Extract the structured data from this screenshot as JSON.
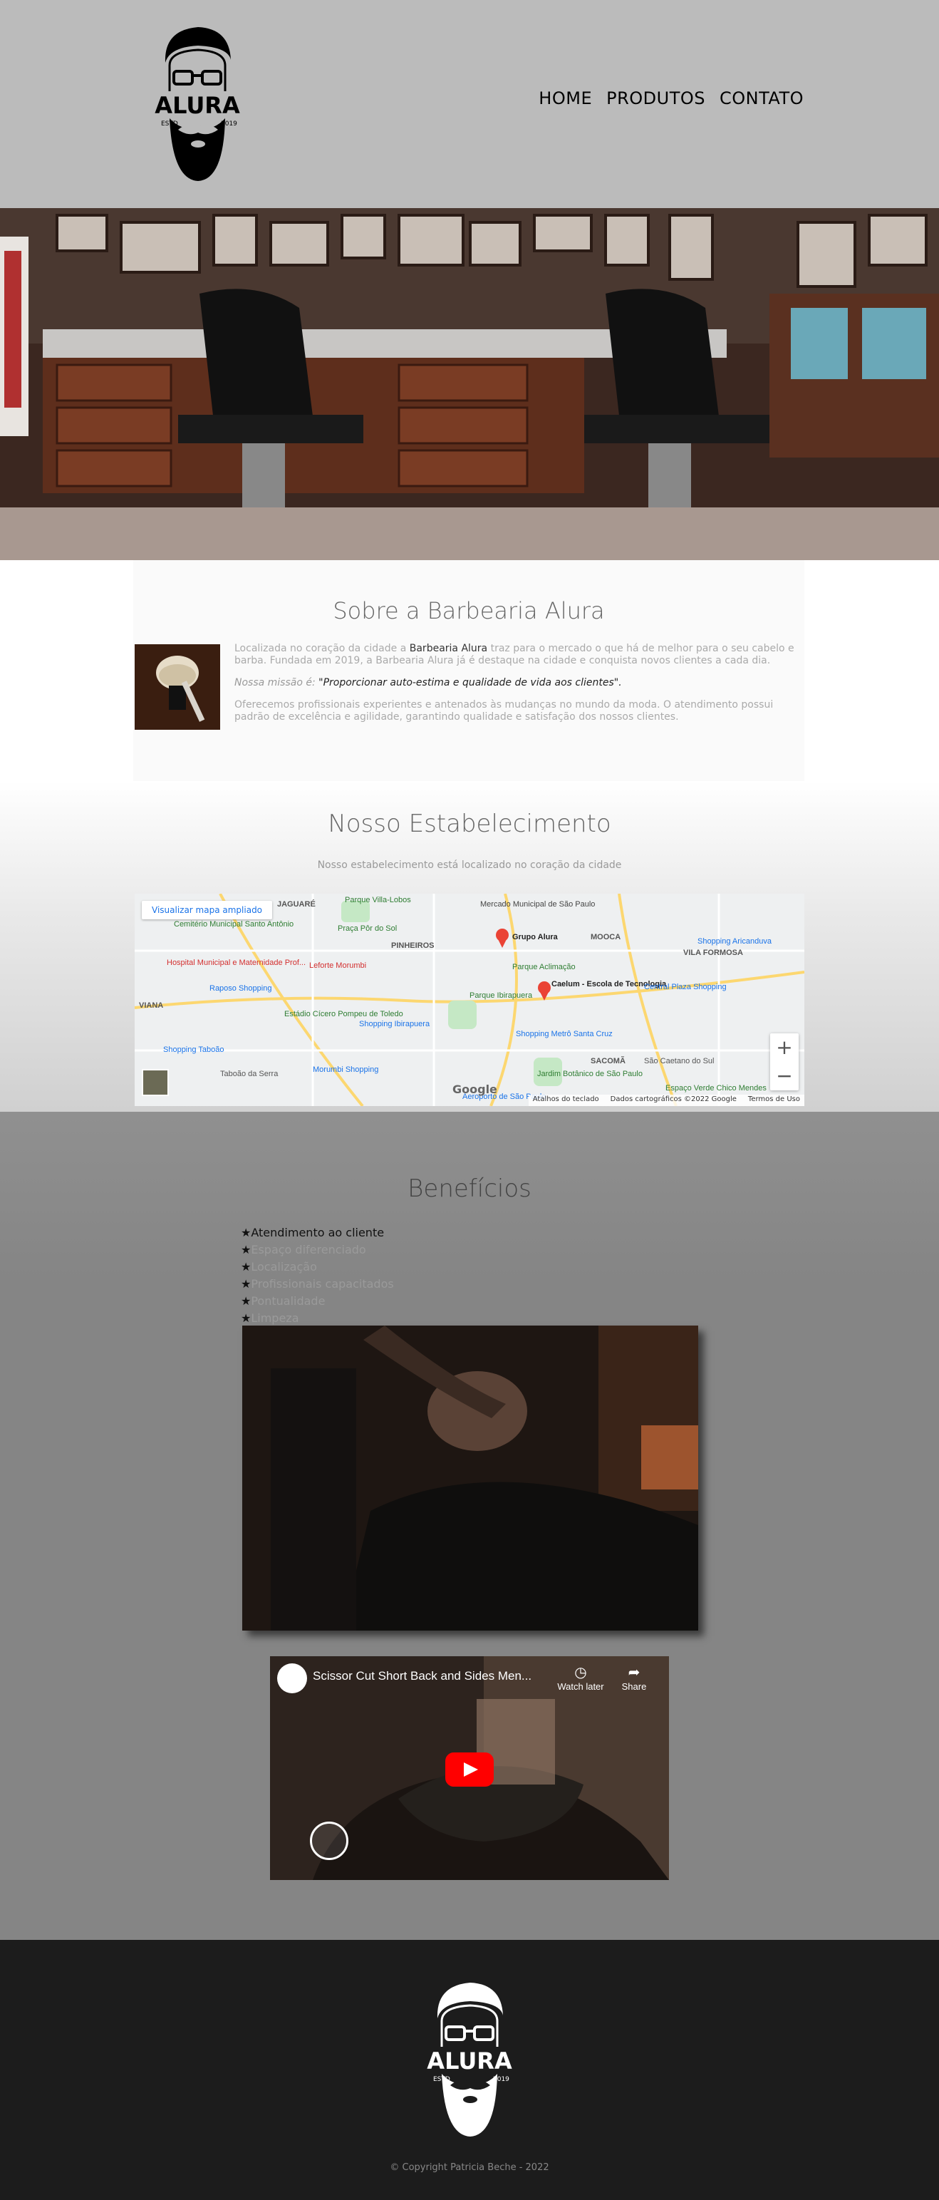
{
  "header": {
    "logo_alt": "Alura barbearia logo",
    "logo_text": "ALURA",
    "logo_estd": "ESTD",
    "logo_year": "2019",
    "nav": [
      {
        "label": "HOME"
      },
      {
        "label": "PRODUTOS"
      },
      {
        "label": "CONTATO"
      }
    ]
  },
  "sobre": {
    "title": "Sobre a Barbearia Alura",
    "p1_a": "Localizada no coração da cidade a ",
    "p1_strong": "Barbearia Alura",
    "p1_b": " traz para o mercado o que há de melhor para o seu cabelo e barba. Fundada em 2019, a Barbearia Alura já é destaque na cidade e conquista novos clientes a cada dia.",
    "p2_em": "Nossa missão é:",
    "p2_quote": " \"Proporcionar auto-estima e qualidade de vida aos clientes\".",
    "p3": "Oferecemos profissionais experientes e antenados às mudanças no mundo da moda. O atendimento possui padrão de excelência e agilidade, garantindo qualidade e satisfação dos nossos clientes."
  },
  "estabelecimento": {
    "title": "Nosso Estabelecimento",
    "subtitle": "Nosso estabelecimento está localizado no coração da cidade",
    "map": {
      "ampliado": "Visualizar mapa ampliado",
      "labels": [
        "JAGUARÉ",
        "Parque Villa-Lobos",
        "Mercado Municipal de São Paulo",
        "Cemitério Municipal Santo Antônio",
        "Praça Pôr do Sol",
        "Grupo Alura",
        "MOOCA",
        "Shopping Aricanduva",
        "Hospital Municipal e Maternidade Prof...",
        "Leforte Morumbi",
        "PINHEIROS",
        "Parque Aclimação",
        "VILA FORMOSA",
        "Raposo Shopping",
        "Parque Ibirapuera",
        "Caelum - Escola de Tecnologia",
        "Central Plaza Shopping",
        "VIANA",
        "Estádio Cícero Pompeu de Toledo",
        "Shopping Ibirapuera",
        "Shopping Metrô Santa Cruz",
        "Shopping Taboão",
        "Taboão da Serra",
        "Morumbi Shopping",
        "SACOMÃ",
        "São Caetano do Sul",
        "Jardim Botânico de São Paulo",
        "Espaço Verde Chico Mendes",
        "Aeroporto de São Paulo"
      ],
      "google": "Google",
      "attr": [
        "Atalhos do teclado",
        "Dados cartográficos ©2022 Google",
        "Termos de Uso"
      ],
      "zoom_in": "+",
      "zoom_out": "−"
    }
  },
  "beneficios": {
    "title": "Benefícios",
    "items": [
      {
        "label": "Atendimento ao cliente"
      },
      {
        "label": "Espaço diferenciado"
      },
      {
        "label": "Localização"
      },
      {
        "label": "Profissionais capacitados"
      },
      {
        "label": "Pontualidade"
      },
      {
        "label": "Limpeza"
      }
    ],
    "star": "★",
    "video": {
      "title": "Scissor Cut Short Back and Sides Men...",
      "watch_later": "Watch later",
      "share": "Share"
    }
  },
  "footer": {
    "copyright": "© Copyright Patricia Beche - 2022"
  }
}
